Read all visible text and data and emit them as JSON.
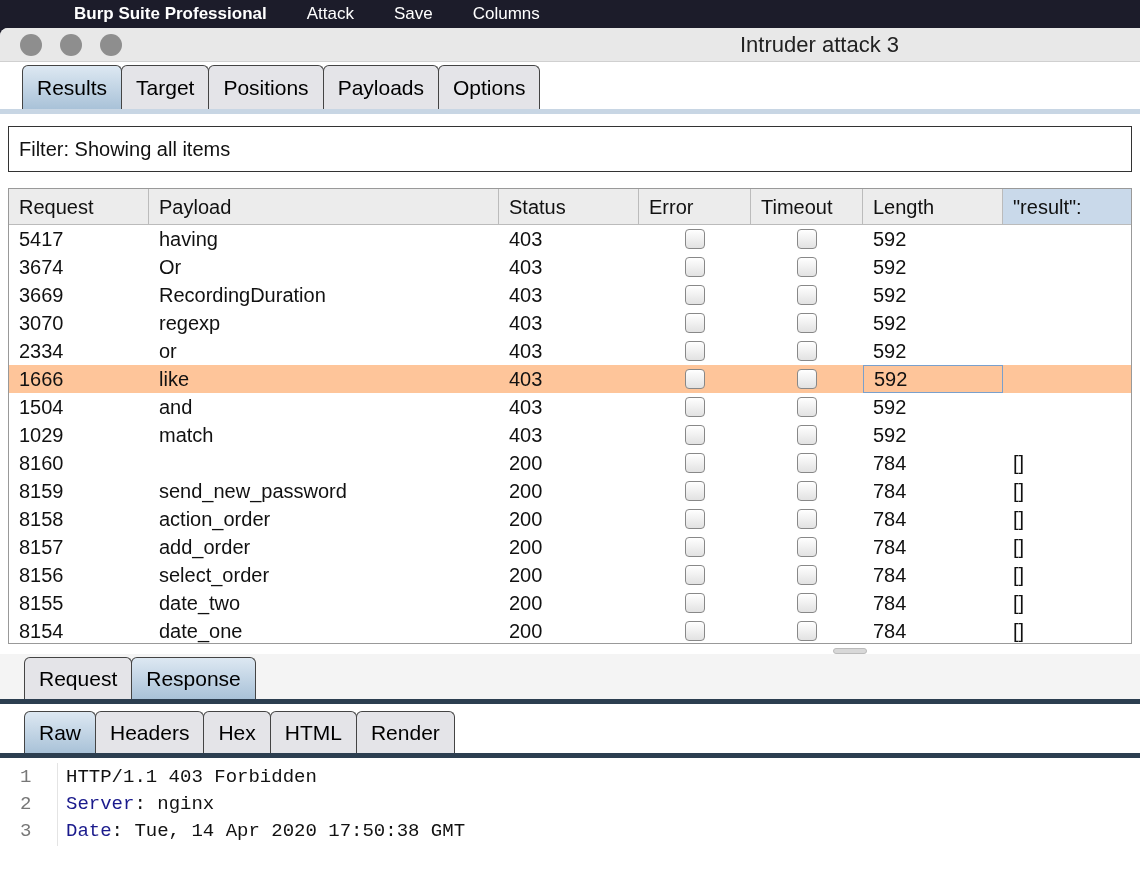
{
  "menu_bar": {
    "app_name": "Burp Suite Professional",
    "items": [
      "Attack",
      "Save",
      "Columns"
    ]
  },
  "window": {
    "title": "Intruder attack 3"
  },
  "tabs": [
    {
      "label": "Results",
      "selected": true
    },
    {
      "label": "Target",
      "selected": false
    },
    {
      "label": "Positions",
      "selected": false
    },
    {
      "label": "Payloads",
      "selected": false
    },
    {
      "label": "Options",
      "selected": false
    }
  ],
  "filter": {
    "text": "Filter: Showing all items"
  },
  "table": {
    "columns": [
      {
        "label": "Request",
        "sorted": false
      },
      {
        "label": "Payload",
        "sorted": false
      },
      {
        "label": "Status",
        "sorted": false
      },
      {
        "label": "Error",
        "sorted": false
      },
      {
        "label": "Timeout",
        "sorted": false
      },
      {
        "label": "Length",
        "sorted": false
      },
      {
        "label": "\"result\":",
        "sorted": true
      }
    ],
    "rows": [
      {
        "request": "5417",
        "payload": "having",
        "status": "403",
        "error": false,
        "timeout": false,
        "length": "592",
        "selected": false
      },
      {
        "request": "3674",
        "payload": "Or",
        "status": "403",
        "error": false,
        "timeout": false,
        "length": "592",
        "selected": false
      },
      {
        "request": "3669",
        "payload": "RecordingDuration",
        "status": "403",
        "error": false,
        "timeout": false,
        "length": "592",
        "selected": false
      },
      {
        "request": "3070",
        "payload": "regexp",
        "status": "403",
        "error": false,
        "timeout": false,
        "length": "592",
        "selected": false
      },
      {
        "request": "2334",
        "payload": "or",
        "status": "403",
        "error": false,
        "timeout": false,
        "length": "592",
        "selected": false
      },
      {
        "request": "1666",
        "payload": "like",
        "status": "403",
        "error": false,
        "timeout": false,
        "length": "592",
        "selected": true
      },
      {
        "request": "1504",
        "payload": "and",
        "status": "403",
        "error": false,
        "timeout": false,
        "length": "592",
        "selected": false
      },
      {
        "request": "1029",
        "payload": "match",
        "status": "403",
        "error": false,
        "timeout": false,
        "length": "592",
        "selected": false
      },
      {
        "request": "8160",
        "status": "200",
        "error": false,
        "timeout": false,
        "length": "784",
        "result": "[]",
        "selected": false
      },
      {
        "request": "8159",
        "payload": "send_new_password",
        "status": "200",
        "error": false,
        "timeout": false,
        "length": "784",
        "result": "[]",
        "selected": false
      },
      {
        "request": "8158",
        "payload": "action_order",
        "status": "200",
        "error": false,
        "timeout": false,
        "length": "784",
        "result": "[]",
        "selected": false
      },
      {
        "request": "8157",
        "payload": "add_order",
        "status": "200",
        "error": false,
        "timeout": false,
        "length": "784",
        "result": "[]",
        "selected": false
      },
      {
        "request": "8156",
        "payload": "select_order",
        "status": "200",
        "error": false,
        "timeout": false,
        "length": "784",
        "result": "[]",
        "selected": false
      },
      {
        "request": "8155",
        "payload": "date_two",
        "status": "200",
        "error": false,
        "timeout": false,
        "length": "784",
        "result": "[]",
        "selected": false
      },
      {
        "request": "8154",
        "payload": "date_one",
        "status": "200",
        "error": false,
        "timeout": false,
        "length": "784",
        "result": "[]",
        "selected": false
      }
    ]
  },
  "message_tabs": [
    {
      "label": "Request",
      "selected": false
    },
    {
      "label": "Response",
      "selected": true
    }
  ],
  "view_tabs": [
    {
      "label": "Raw",
      "selected": true
    },
    {
      "label": "Headers",
      "selected": false
    },
    {
      "label": "Hex",
      "selected": false
    },
    {
      "label": "HTML",
      "selected": false
    },
    {
      "label": "Render",
      "selected": false
    }
  ],
  "response_lines": [
    {
      "number": "1",
      "text": "HTTP/1.1 403 Forbidden"
    },
    {
      "number": "2",
      "key": "Server",
      "text": ": nginx"
    },
    {
      "number": "3",
      "key": "Date",
      "text": ": Tue, 14 Apr 2020 17:50:38 GMT"
    }
  ]
}
